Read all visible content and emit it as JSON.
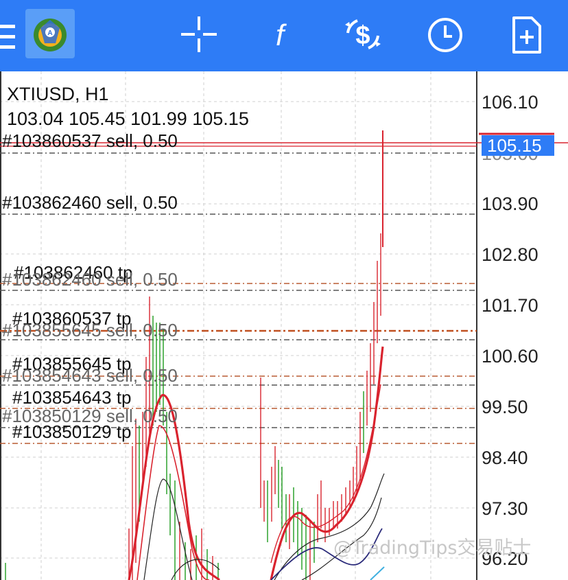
{
  "toolbar": {
    "icons": [
      "menu-icon",
      "metatrader-logo-icon",
      "crosshair-icon",
      "indicators-icon",
      "trade-icon",
      "history-clock-icon",
      "new-order-icon"
    ],
    "indicators_glyph": "f",
    "color": "#2e7cf6"
  },
  "chart": {
    "symbol": "XTIUSD, H1",
    "ohlc": "103.04 105.45 101.99 105.15",
    "current_price": "105.15",
    "price_labels": [
      "106.10",
      "105.00",
      "103.90",
      "102.80",
      "101.70",
      "100.60",
      "99.50",
      "98.40",
      "97.30",
      "96.20"
    ],
    "orders": [
      "#103860537 sell, 0.50",
      "#103862460 sell, 0.50",
      "#103862460 tp",
      "#103862460 sell, 0.50",
      "#103860537 tp",
      "#103855645 sell, 0.50",
      "#103855645 tp",
      "#103854643 sell, 0.50",
      "#103854643 tp",
      "#103850129 sell, 0.50",
      "#103850129 tp"
    ],
    "colors": {
      "bid_line": "#d9232e",
      "ask_line": "#d9232e",
      "price_badge": "#2e7cf6",
      "bull_candle": "#1d9b1d",
      "bear_candle": "#d9232e",
      "ma_fast": "#d9232e",
      "ma_slow": "#222222",
      "ma_long": "#2b2b7a"
    }
  },
  "watermark": "@TradingTips交易贴士"
}
